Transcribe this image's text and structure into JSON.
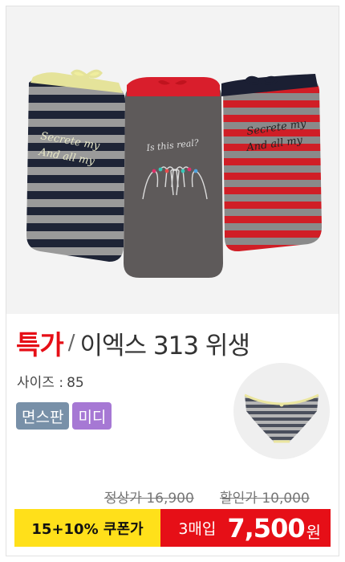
{
  "product": {
    "tag": "특가",
    "separator": "/",
    "name": "이엑스 313 위생",
    "size_label": "사이즈 :",
    "size_value": "85",
    "badges": [
      "면스판",
      "미디"
    ],
    "original_price": "정상가 16,900",
    "discount_price": "할인가 10,000",
    "coupon_label": "15+10% 쿠폰가",
    "bundle_label": "3매입",
    "final_price": "7,500",
    "currency": "원"
  },
  "photo_text": {
    "left_pack": "Secrete my",
    "left_pack_2": "And all my",
    "middle_pack": "Is this real?",
    "right_pack": "Secrete my",
    "right_pack_2": "And all my"
  },
  "colors": {
    "accent_red": "#e60f17",
    "coupon_yellow": "#ffe01a",
    "badge_cotton": "#7890a8",
    "badge_midi": "#a678d4"
  }
}
